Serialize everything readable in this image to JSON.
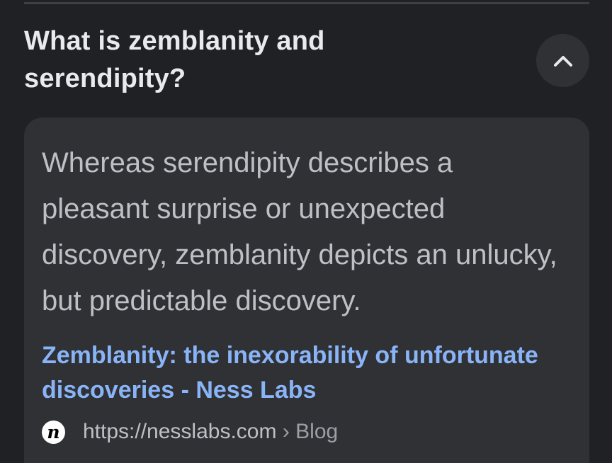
{
  "faq": {
    "question": "What is zemblanity and serendipity?",
    "toggle_icon": "chevron-up-icon",
    "answer": "Whereas serendipity describes a pleasant surprise or unexpected discovery, zemblanity depicts an unlucky, but predictable discovery.",
    "source": {
      "title": "Zemblanity: the inexorability of unfortunate discoveries - Ness Labs",
      "favicon_glyph": "n",
      "url": "https://nesslabs.com",
      "separator": "›",
      "breadcrumb": "Blog"
    }
  },
  "colors": {
    "background": "#202124",
    "card": "#303134",
    "question_text": "#e8eaed",
    "answer_text": "#bdc1c6",
    "link": "#8ab4f8"
  }
}
